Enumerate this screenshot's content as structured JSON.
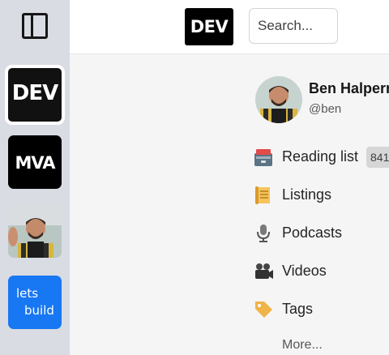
{
  "rail": {
    "communities": [
      {
        "name": "dev",
        "label": "DEV",
        "active": true
      },
      {
        "name": "mva",
        "label": "MVA"
      },
      {
        "name": "photo"
      },
      {
        "name": "letsbuild",
        "line1": "lets",
        "line2": "build"
      }
    ]
  },
  "header": {
    "logo": "DEV",
    "search_placeholder": "Search..."
  },
  "profile": {
    "name": "Ben Halpern",
    "handle": "@ben"
  },
  "nav": {
    "items": [
      {
        "label": "Reading list",
        "count": "841",
        "icon": "reading-list-icon"
      },
      {
        "label": "Listings",
        "icon": "scroll-icon"
      },
      {
        "label": "Podcasts",
        "icon": "microphone-icon"
      },
      {
        "label": "Videos",
        "icon": "film-camera-icon"
      },
      {
        "label": "Tags",
        "icon": "tag-icon"
      }
    ],
    "more": "More..."
  }
}
